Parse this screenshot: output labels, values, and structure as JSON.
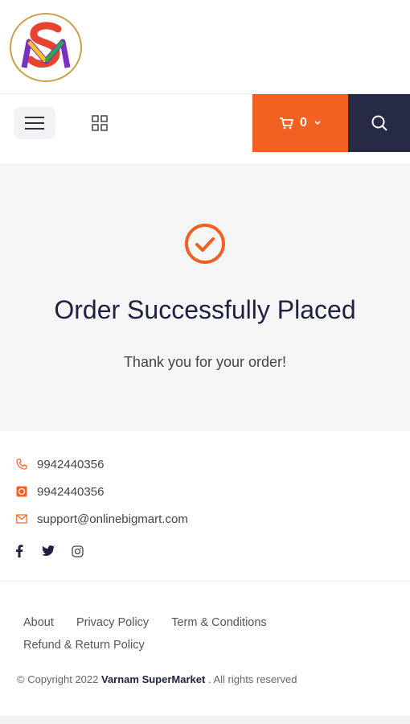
{
  "header": {
    "logo_text": "SM",
    "cart_count": "0"
  },
  "hero": {
    "title": "Order Successfully Placed",
    "subtitle": "Thank you for your order!"
  },
  "contact": {
    "phone": "9942440356",
    "whatsapp": "9942440356",
    "email": "support@onlinebigmart.com"
  },
  "social": [
    "facebook-icon",
    "twitter-icon",
    "instagram-icon"
  ],
  "footer": {
    "links": [
      "About",
      "Privacy Policy",
      "Term & Conditions",
      "Refund & Return Policy"
    ],
    "copyright_prefix": "© Copyright 2022",
    "brand": "Varnam SuperMarket",
    "copyright_suffix": ". All rights reserved"
  },
  "colors": {
    "accent": "#f26122",
    "dark": "#262a46"
  }
}
